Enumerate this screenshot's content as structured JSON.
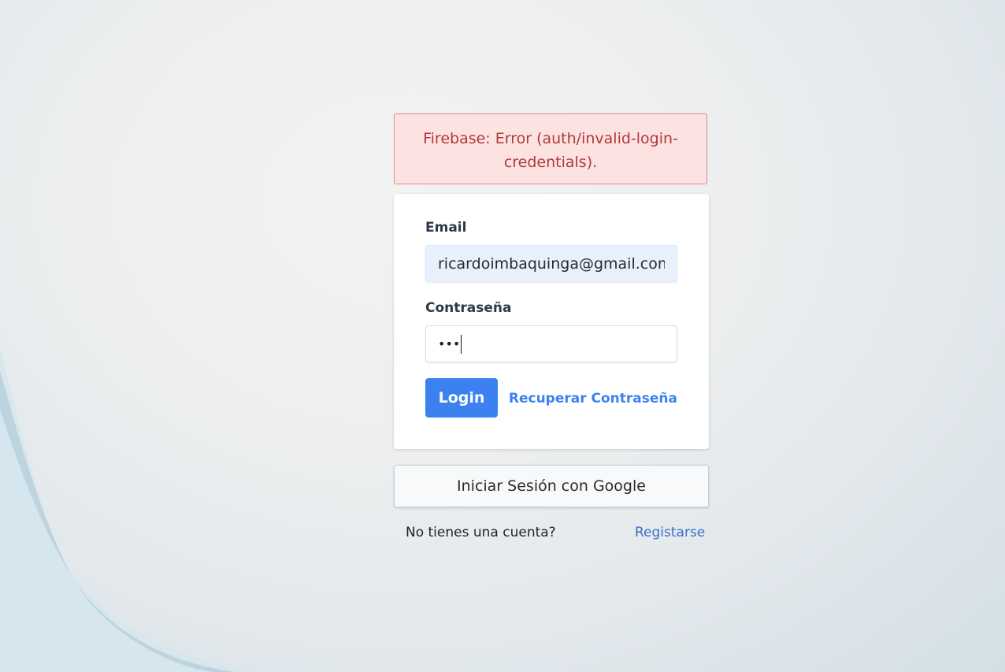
{
  "error": {
    "message": "Firebase: Error (auth/invalid-login-credentials)."
  },
  "form": {
    "email_label": "Email",
    "email_value": "ricardoimbaquinga@gmail.com",
    "password_label": "Contraseña",
    "password_masked": "•••",
    "login_label": "Login",
    "recover_label": "Recuperar Contraseña"
  },
  "google": {
    "label": "Iniciar Sesión con Google"
  },
  "footer": {
    "no_account_text": "No tienes una cuenta?",
    "register_label": "Registarse"
  },
  "colors": {
    "primary": "#3b82f0",
    "error_bg": "#fde2e2",
    "error_text": "#b0393b"
  }
}
